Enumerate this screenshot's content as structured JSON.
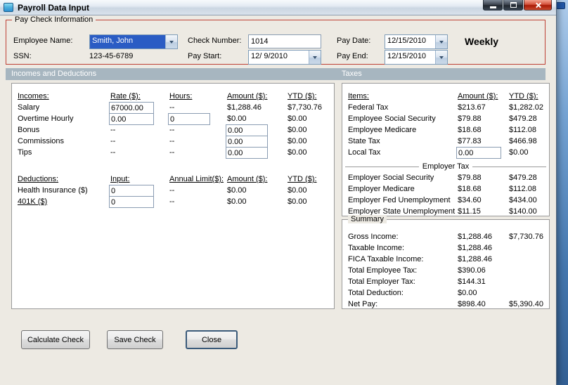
{
  "window": {
    "title": "Payroll Data Input"
  },
  "colors": {
    "form-bg": "#EDEAE3",
    "section-header-bg": "#A7B6C0",
    "paycheck-border": "#BE3F34",
    "selection-bg": "#2A5CC4"
  },
  "paycheck": {
    "group_label": "Pay Check Information",
    "employee_name_label": "Employee Name:",
    "employee_name_value": "Smith, John",
    "ssn_label": "SSN:",
    "ssn_value": "123-45-6789",
    "check_number_label": "Check Number:",
    "check_number_value": "1014",
    "pay_start_label": "Pay Start:",
    "pay_start_value": "12/ 9/2010",
    "pay_date_label": "Pay Date:",
    "pay_date_value": "12/15/2010",
    "pay_end_label": "Pay End:",
    "pay_end_value": "12/15/2010",
    "frequency": "Weekly"
  },
  "section_headers": {
    "left": "Incomes and Deductions",
    "right": "Taxes"
  },
  "incomes": {
    "headers": {
      "c1": "Incomes:",
      "c2": "Rate ($):",
      "c3": "Hours:",
      "c4": "Amount ($):",
      "c5": "YTD ($):"
    },
    "rows": [
      {
        "label": "Salary",
        "rate": "67000.00",
        "hours": "--",
        "amount": "$1,288.46",
        "ytd": "$7,730.76"
      },
      {
        "label": "Overtime Hourly",
        "rate": "0.00",
        "hours": "0",
        "amount": "$0.00",
        "ytd": "$0.00"
      },
      {
        "label": "Bonus",
        "rate": "--",
        "hours": "--",
        "amount": "0.00",
        "ytd": "$0.00"
      },
      {
        "label": "Commissions",
        "rate": "--",
        "hours": "--",
        "amount": "0.00",
        "ytd": "$0.00"
      },
      {
        "label": "Tips",
        "rate": "--",
        "hours": "--",
        "amount": "0.00",
        "ytd": "$0.00"
      }
    ]
  },
  "deductions": {
    "headers": {
      "c1": "Deductions:",
      "c2": "Input:",
      "c3": "Annual Limit($):",
      "c4": "Amount ($):",
      "c5": "YTD ($):"
    },
    "rows": [
      {
        "label": "Health Insurance ($)",
        "input": "0",
        "limit": "--",
        "amount": "$0.00",
        "ytd": "$0.00"
      },
      {
        "label": "401K ($)",
        "input": "0",
        "limit": "--",
        "amount": "$0.00",
        "ytd": "$0.00"
      }
    ]
  },
  "taxes": {
    "headers": {
      "c1": "Items:",
      "c2": "Amount ($):",
      "c3": "YTD ($):"
    },
    "employee_rows": [
      {
        "label": "Federal Tax",
        "amount": "$213.67",
        "ytd": "$1,282.02"
      },
      {
        "label": "Employee Social Security",
        "amount": "$79.88",
        "ytd": "$479.28"
      },
      {
        "label": "Employee Medicare",
        "amount": "$18.68",
        "ytd": "$112.08"
      },
      {
        "label": "State Tax",
        "amount": "$77.83",
        "ytd": "$466.98"
      },
      {
        "label": "Local Tax",
        "amount": "0.00",
        "ytd": "$0.00"
      }
    ],
    "employer_group_label": "Employer Tax",
    "employer_rows": [
      {
        "label": "Employer Social Security",
        "amount": "$79.88",
        "ytd": "$479.28"
      },
      {
        "label": "Employer Medicare",
        "amount": "$18.68",
        "ytd": "$112.08"
      },
      {
        "label": "Employer Fed Unemployment",
        "amount": "$34.60",
        "ytd": "$434.00"
      },
      {
        "label": "Employer State Unemployment",
        "amount": "$11.15",
        "ytd": "$140.00"
      }
    ]
  },
  "summary": {
    "group_label": "Summary",
    "rows": [
      {
        "label": "Gross Income:",
        "amount": "$1,288.46",
        "ytd": "$7,730.76"
      },
      {
        "label": "Taxable Income:",
        "amount": "$1,288.46",
        "ytd": ""
      },
      {
        "label": "FICA Taxable Income:",
        "amount": "$1,288.46",
        "ytd": ""
      },
      {
        "label": "Total Employee Tax:",
        "amount": "$390.06",
        "ytd": ""
      },
      {
        "label": "Total Employer Tax:",
        "amount": "$144.31",
        "ytd": ""
      },
      {
        "label": "Total Deduction:",
        "amount": "$0.00",
        "ytd": ""
      },
      {
        "label": "Net Pay:",
        "amount": "$898.40",
        "ytd": "$5,390.40"
      }
    ]
  },
  "buttons": {
    "calculate": "Calculate Check",
    "save": "Save Check",
    "close": "Close"
  }
}
